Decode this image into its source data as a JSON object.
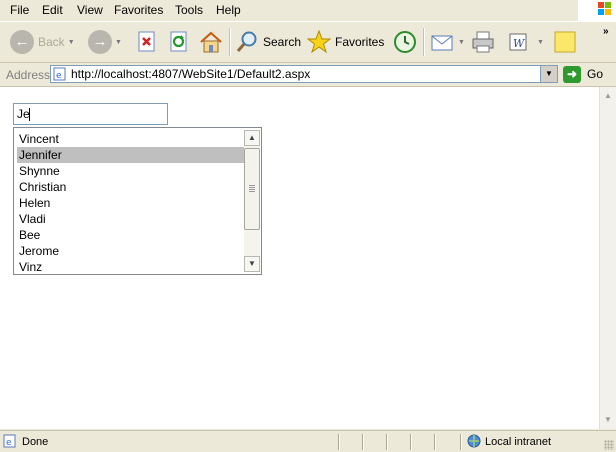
{
  "menubar": {
    "items": [
      "File",
      "Edit",
      "View",
      "Favorites",
      "Tools",
      "Help"
    ]
  },
  "toolbar": {
    "back_label": "Back",
    "search_label": "Search",
    "favorites_label": "Favorites"
  },
  "addressbar": {
    "label": "Address",
    "url": "http://localhost:4807/WebSite1/Default2.aspx",
    "go_label": "Go"
  },
  "page": {
    "search_value": "Je",
    "suggestions": [
      "Vincent",
      "Jennifer",
      "Shynne",
      "Christian",
      "Helen",
      "Vladi",
      "Bee",
      "Jerome",
      "Vinz"
    ],
    "selected_suggestion": "Jennifer"
  },
  "statusbar": {
    "status": "Done",
    "zone": "Local intranet"
  },
  "colors": {
    "selection": "#bfbfbf",
    "chrome": "#ece9d8",
    "go_green": "#2e9a2e"
  }
}
